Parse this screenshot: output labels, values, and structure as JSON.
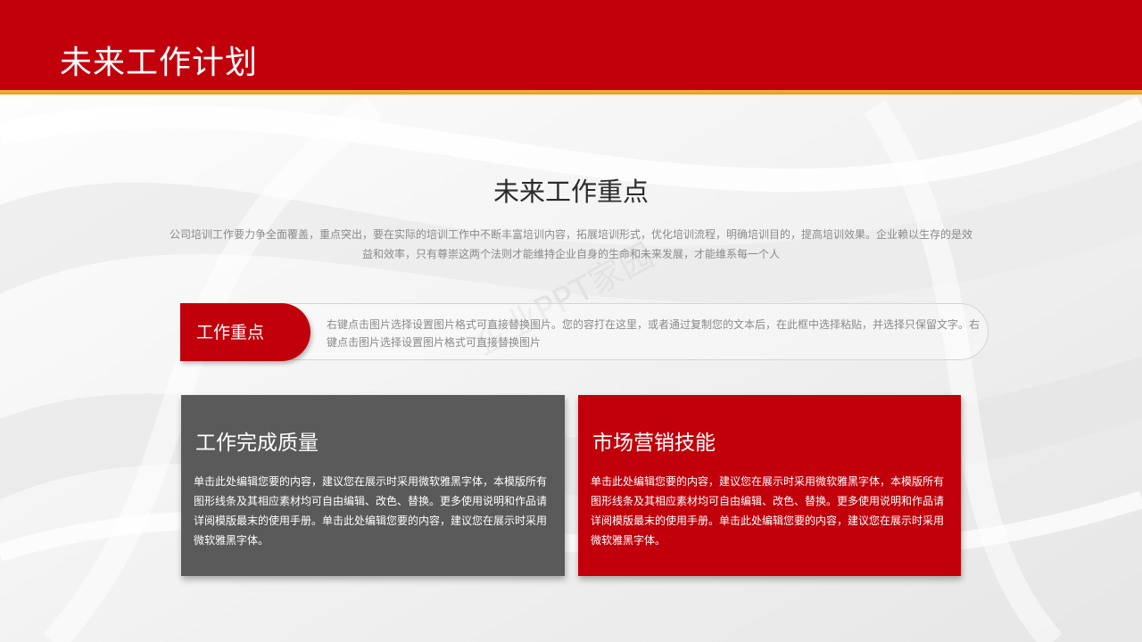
{
  "header": {
    "title": "未来工作计划"
  },
  "section": {
    "title": "未来工作重点",
    "intro": "公司培训工作要力争全面覆盖，重点突出，要在实际的培训工作中不断丰富培训内容，拓展培训形式，优化培训流程，明确培训目的，提高培训效果。企业赖以生存的是效益和效率，只有尊崇这两个法则才能维持企业自身的生命和未来发展，才能维系每一个人"
  },
  "focus": {
    "label": "工作重点",
    "text": "右键点击图片选择设置图片格式可直接替换图片。您的容打在这里，或者通过复制您的文本后，在此框中选择粘贴，并选择只保留文字。右键点击图片选择设置图片格式可直接替换图片"
  },
  "cards": [
    {
      "title": "工作完成质量",
      "body": "单击此处编辑您要的内容，建议您在展示时采用微软雅黑字体，本模版所有图形线条及其相应素材均可自由编辑、改色、替换。更多使用说明和作品请详阅模版最末的使用手册。单击此处编辑您要的内容，建议您在展示时采用微软雅黑字体。",
      "color": "#5a5a5a"
    },
    {
      "title": "市场营销技能",
      "body": "单击此处编辑您要的内容，建议您在展示时采用微软雅黑字体，本模版所有图形线条及其相应素材均可自由编辑、改色、替换。更多使用说明和作品请详阅模版最末的使用手册。单击此处编辑您要的内容，建议您在展示时采用微软雅黑字体。",
      "color": "#c1000b"
    }
  ],
  "watermark": "企业PPT家园",
  "colors": {
    "brand_red": "#c1000b",
    "accent_gold": "#e59a1c",
    "dark_gray": "#5a5a5a"
  }
}
